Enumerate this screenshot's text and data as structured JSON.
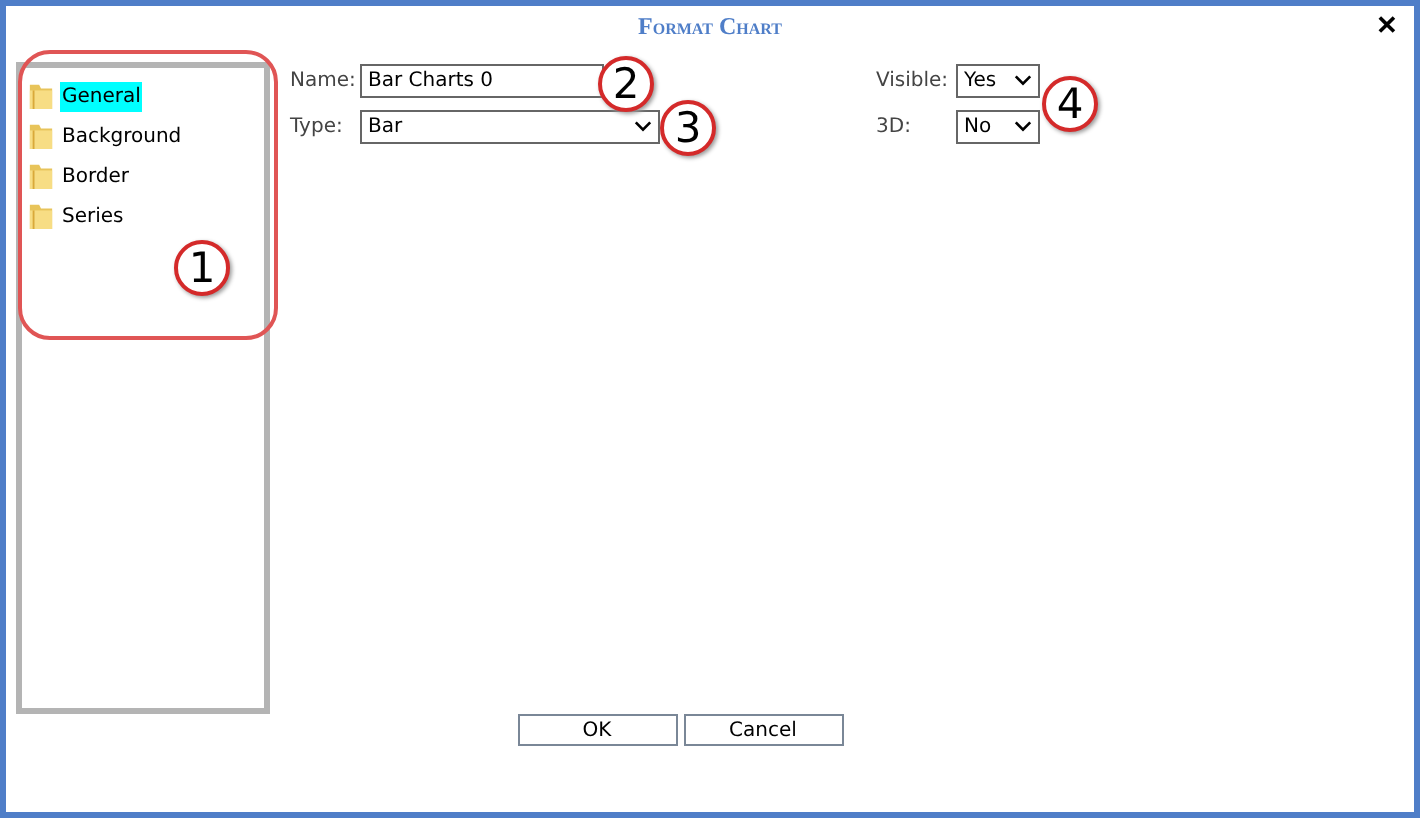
{
  "window": {
    "title": "Format Chart",
    "close": "✕"
  },
  "tree": {
    "items": [
      {
        "label": "General",
        "selected": true
      },
      {
        "label": "Background",
        "selected": false
      },
      {
        "label": "Border",
        "selected": false
      },
      {
        "label": "Series",
        "selected": false
      }
    ]
  },
  "fields": [
    {
      "kind": "text",
      "label": "Name:",
      "value": "Bar Charts 0"
    },
    {
      "kind": "select",
      "label": "Type:",
      "value": "Bar"
    }
  ],
  "side_fields": [
    {
      "kind": "select",
      "label": "Visible:",
      "value": "Yes"
    },
    {
      "kind": "select",
      "label": "3D:",
      "value": "No"
    }
  ],
  "buttons": [
    "OK",
    "Cancel"
  ],
  "callouts": [
    "1",
    "2",
    "3",
    "4"
  ]
}
